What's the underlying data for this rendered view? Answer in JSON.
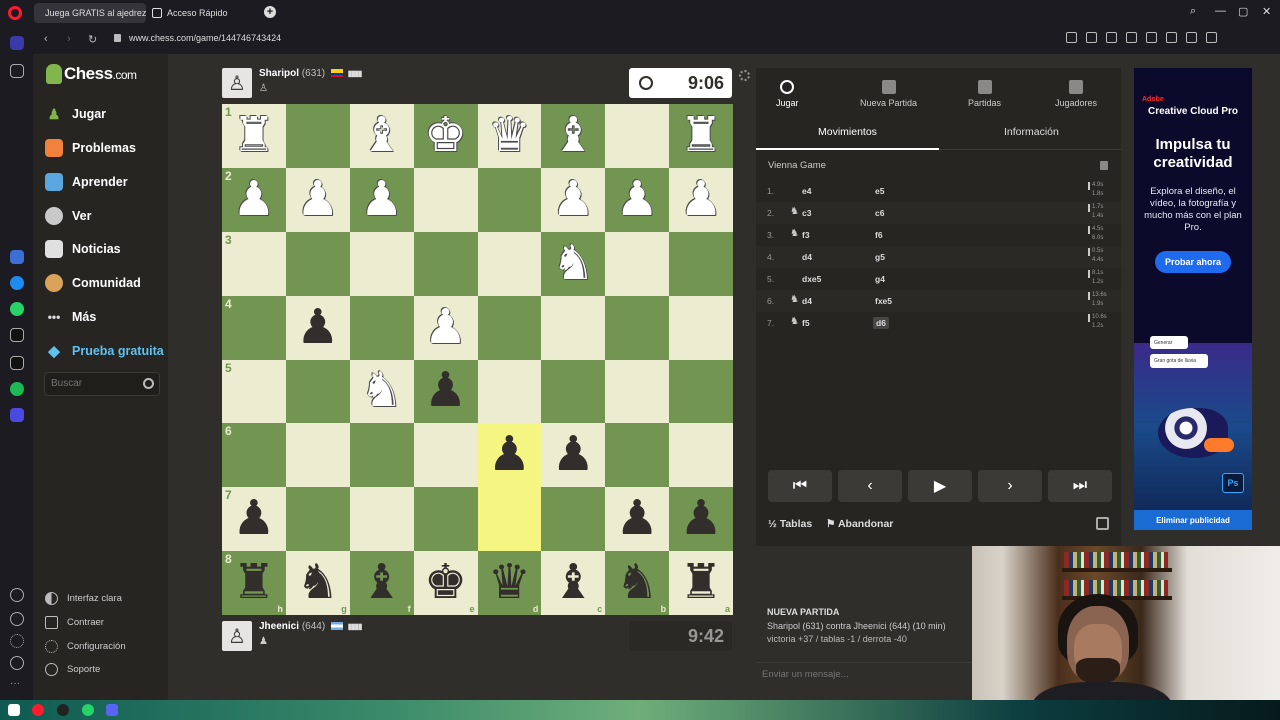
{
  "browser": {
    "tabs": [
      {
        "label": "Juega GRATIS al ajedrez o",
        "active": true
      },
      {
        "label": "Acceso Rápido",
        "active": false
      }
    ],
    "url": "www.chess.com/game/144746743424"
  },
  "nav": {
    "logo": "Chess",
    "logo_suffix": ".com",
    "items": [
      {
        "label": "Jugar",
        "icon": "pawn-icon"
      },
      {
        "label": "Problemas",
        "icon": "puzzle-icon"
      },
      {
        "label": "Aprender",
        "icon": "learn-icon"
      },
      {
        "label": "Ver",
        "icon": "watch-icon"
      },
      {
        "label": "Noticias",
        "icon": "news-icon"
      },
      {
        "label": "Comunidad",
        "icon": "community-icon"
      },
      {
        "label": "Más",
        "icon": "more-icon"
      },
      {
        "label": "Prueba gratuita",
        "icon": "diamond-icon"
      }
    ],
    "search_placeholder": "Buscar",
    "footer": [
      {
        "label": "Interfaz clara",
        "icon": "theme-icon"
      },
      {
        "label": "Contraer",
        "icon": "collapse-icon"
      },
      {
        "label": "Configuración",
        "icon": "settings-icon"
      },
      {
        "label": "Soporte",
        "icon": "help-icon"
      }
    ]
  },
  "players": {
    "top": {
      "name": "Sharipol",
      "rating": "(631)",
      "clock": "9:06"
    },
    "bottom": {
      "name": "Jheenici",
      "rating": "(644)",
      "clock": "9:42"
    }
  },
  "board": {
    "ranks": [
      "1",
      "2",
      "3",
      "4",
      "5",
      "6",
      "7",
      "8"
    ],
    "files": [
      "h",
      "g",
      "f",
      "e",
      "d",
      "c",
      "b",
      "a"
    ],
    "rows": [
      [
        "wR",
        "",
        "wB",
        "wK",
        "wQ",
        "wB",
        "",
        "wR"
      ],
      [
        "wP",
        "wP",
        "wP",
        "",
        "",
        "wP",
        "wP",
        "wP"
      ],
      [
        "",
        "",
        "",
        "",
        "",
        "wN",
        "",
        ""
      ],
      [
        "",
        "bP",
        "",
        "wP",
        "",
        "",
        "",
        ""
      ],
      [
        "",
        "",
        "wN",
        "bP",
        "",
        "",
        "",
        ""
      ],
      [
        "",
        "",
        "",
        "",
        "bP",
        "bP",
        "",
        ""
      ],
      [
        "bP",
        "",
        "",
        "",
        "",
        "",
        "bP",
        "bP"
      ],
      [
        "bR",
        "bN",
        "bB",
        "bK",
        "bQ",
        "bB",
        "bN",
        "bR"
      ]
    ],
    "highlight": [
      [
        5,
        4
      ],
      [
        6,
        4
      ]
    ],
    "colors": {
      "light": "#ebecd0",
      "dark": "#739552",
      "highlight": "#f5f682"
    }
  },
  "panel": {
    "tabs": [
      {
        "label": "Jugar",
        "icon": "clock-icon"
      },
      {
        "label": "Nueva Partida",
        "icon": "plus-icon"
      },
      {
        "label": "Partidas",
        "icon": "board-icon"
      },
      {
        "label": "Jugadores",
        "icon": "players-icon"
      }
    ],
    "subtabs": [
      "Movimientos",
      "Información"
    ],
    "opening": "Vienna Game",
    "moves": [
      {
        "n": "1.",
        "w": "e4",
        "b": "e5",
        "tw": "4.9s",
        "tb": "1.8s"
      },
      {
        "n": "2.",
        "w": "c3",
        "wp": true,
        "b": "c6",
        "tw": "1.7s",
        "tb": "1.4s"
      },
      {
        "n": "3.",
        "w": "f3",
        "wp": true,
        "b": "f6",
        "tw": "4.5s",
        "tb": "6.0s"
      },
      {
        "n": "4.",
        "w": "d4",
        "b": "g5",
        "tw": "0.5s",
        "tb": "4.4s"
      },
      {
        "n": "5.",
        "w": "dxe5",
        "b": "g4",
        "tw": "8.1s",
        "tb": "1.2s"
      },
      {
        "n": "6.",
        "w": "d4",
        "wp": true,
        "b": "fxe5",
        "tw": "13.6s",
        "tb": "1.9s"
      },
      {
        "n": "7.",
        "w": "f5",
        "wp": true,
        "b": "d6",
        "tw": "10.6s",
        "tb": "1.2s"
      }
    ],
    "draw": "Tablas",
    "resign": "Abandonar",
    "new_game_title": "NUEVA PARTIDA",
    "new_game_line1": "Sharipol (631) contra Jheenici (644) (10 min)",
    "new_game_line2": "victoria +37 / tablas -1 / derrota -40",
    "chat_placeholder": "Enviar un mensaje..."
  },
  "ad": {
    "brand": "Adobe",
    "product": "Creative Cloud Pro",
    "headline": "Impulsa tu creatividad",
    "body": "Explora el diseño, el vídeo, la fotografía y mucho más con el plan Pro.",
    "cta": "Probar ahora",
    "chip1": "Generar",
    "chip2": "Gran gota de lluvia",
    "badge": "Ps",
    "remove": "Eliminar publicidad"
  }
}
